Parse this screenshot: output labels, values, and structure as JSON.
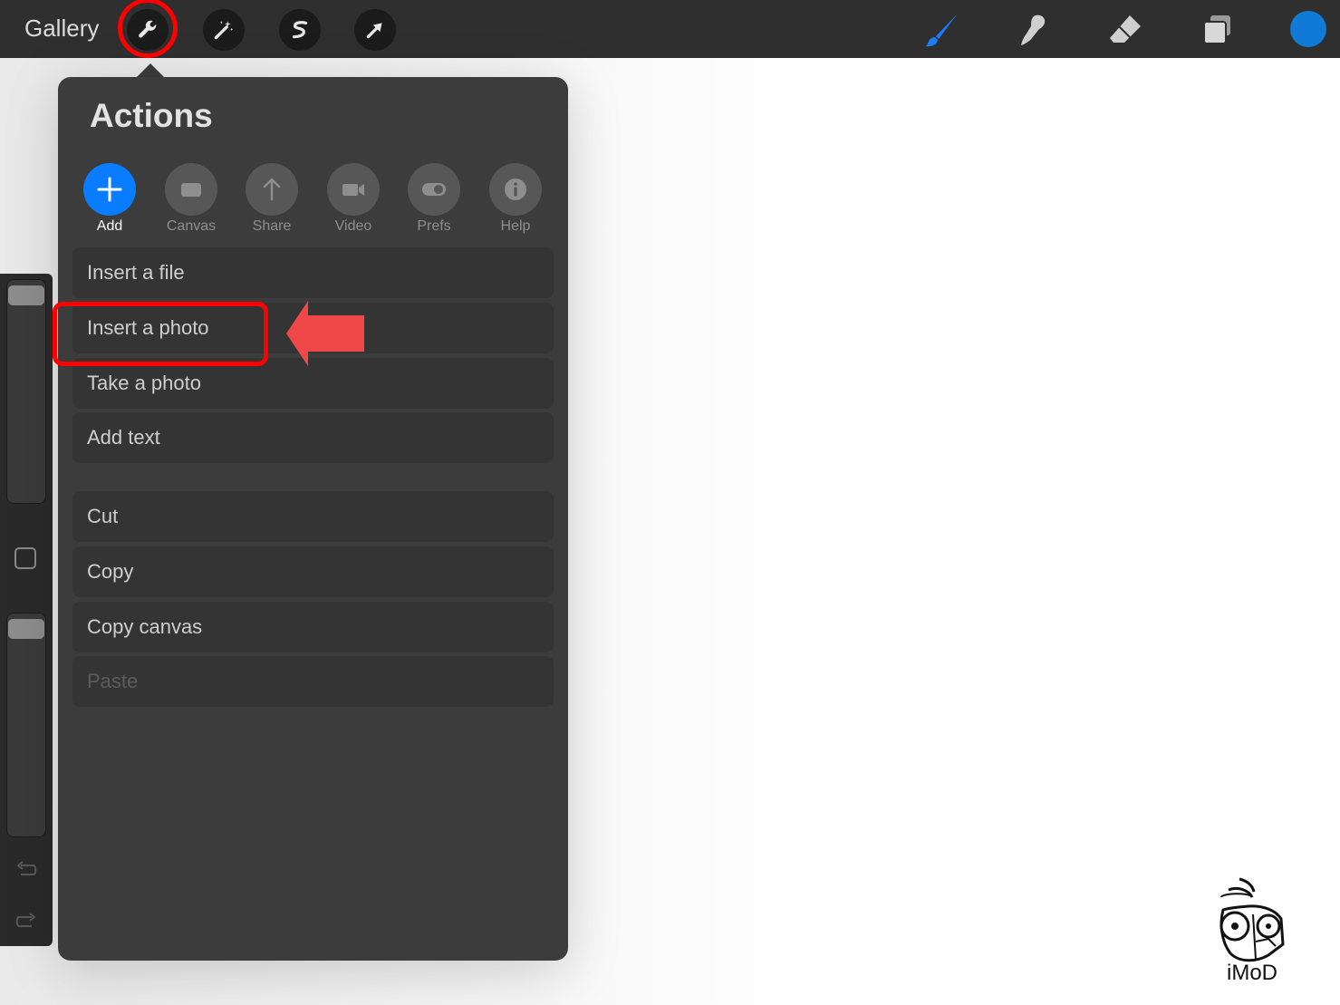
{
  "toolbar": {
    "gallery_label": "Gallery",
    "left_tools": [
      {
        "name": "actions",
        "icon": "wrench-icon"
      },
      {
        "name": "adjustments",
        "icon": "magic-wand-icon"
      },
      {
        "name": "selection",
        "icon": "selection-icon"
      },
      {
        "name": "transform",
        "icon": "transform-arrow-icon"
      }
    ],
    "right_tools": [
      {
        "name": "brush",
        "icon": "brush-icon",
        "active": true
      },
      {
        "name": "smudge",
        "icon": "smudge-icon"
      },
      {
        "name": "eraser",
        "icon": "eraser-icon"
      },
      {
        "name": "layers",
        "icon": "layers-icon"
      }
    ],
    "current_color": "#0f7bd6",
    "active_color": "#1a7cff"
  },
  "actions_panel": {
    "title": "Actions",
    "tabs": [
      {
        "label": "Add",
        "icon": "plus-icon",
        "active": true
      },
      {
        "label": "Canvas",
        "icon": "canvas-icon"
      },
      {
        "label": "Share",
        "icon": "share-arrow-icon"
      },
      {
        "label": "Video",
        "icon": "video-camera-icon"
      },
      {
        "label": "Prefs",
        "icon": "toggle-icon"
      },
      {
        "label": "Help",
        "icon": "info-icon"
      }
    ],
    "items_group1": [
      "Insert a file",
      "Insert a photo",
      "Take a photo",
      "Add text"
    ],
    "items_group2": [
      "Cut",
      "Copy",
      "Copy canvas",
      "Paste"
    ],
    "disabled_items": [
      "Paste"
    ]
  },
  "annotation_color": "#ff0000",
  "arrow_color": "#f04848",
  "watermark": {
    "text": "iMoD"
  }
}
